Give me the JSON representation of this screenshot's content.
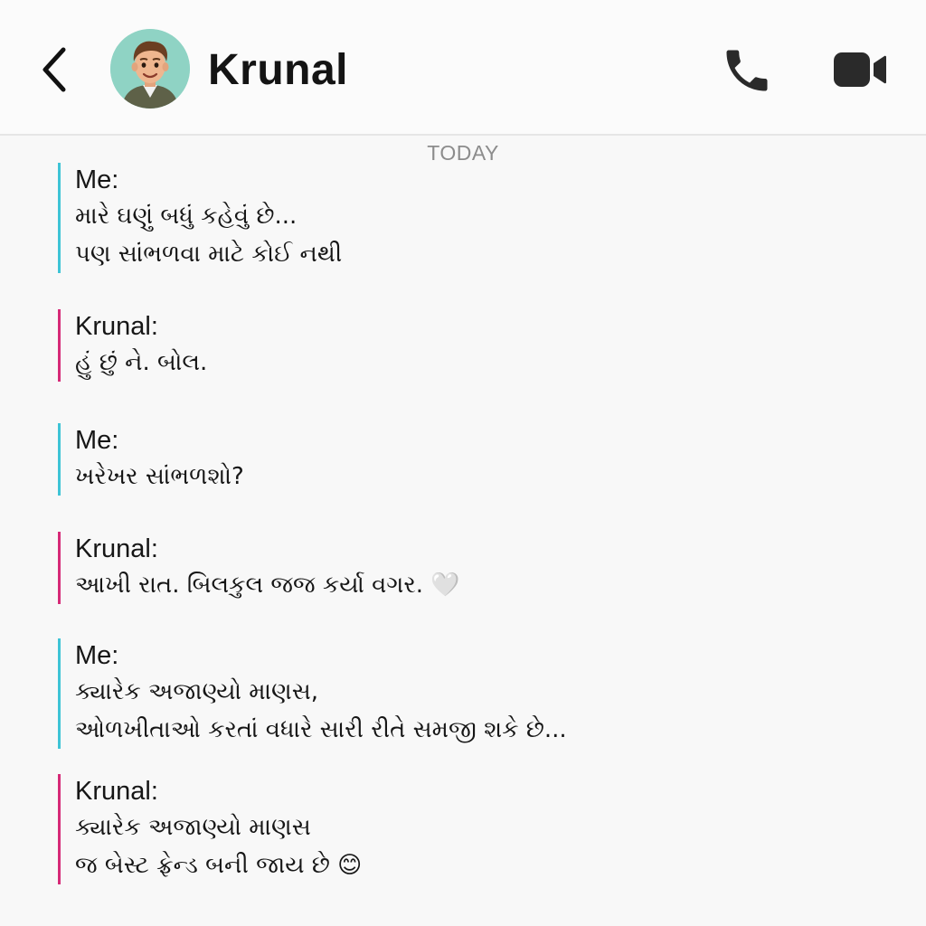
{
  "header": {
    "contact_name": "Krunal",
    "back_icon": "chevron-left-icon",
    "call_icon": "phone-icon",
    "video_icon": "video-camera-icon"
  },
  "date_separator": "TODAY",
  "colors": {
    "me_accent": "#3fc4d6",
    "them_accent": "#d62a77"
  },
  "messages": [
    {
      "sender": "Me:",
      "from": "me",
      "lines": [
        "મારે ઘણું બધું કહેવું છે...",
        "પણ સાંભળવા માટે કોઈ નથી"
      ]
    },
    {
      "sender": "Krunal:",
      "from": "them",
      "lines": [
        "હું છું ને. બોલ."
      ]
    },
    {
      "sender": "Me:",
      "from": "me",
      "lines": [
        "ખરેખર સાંભળશો?"
      ]
    },
    {
      "sender": "Krunal:",
      "from": "them",
      "lines": [
        "આખી રાત. બિલકુલ જજ કર્યા વગર. 🤍"
      ]
    },
    {
      "sender": "Me:",
      "from": "me",
      "lines": [
        "ક્યારેક અજાણ્યો માણસ,",
        "ઓળખીતાઓ કરતાં વધારે સારી રીતે સમજી શકે છે..."
      ]
    },
    {
      "sender": "Krunal:",
      "from": "them",
      "lines": [
        "ક્યારેક અજાણ્યો માણસ",
        "જ બેસ્ટ ફ્રેન્ડ બની જાય છે 😊"
      ]
    }
  ]
}
